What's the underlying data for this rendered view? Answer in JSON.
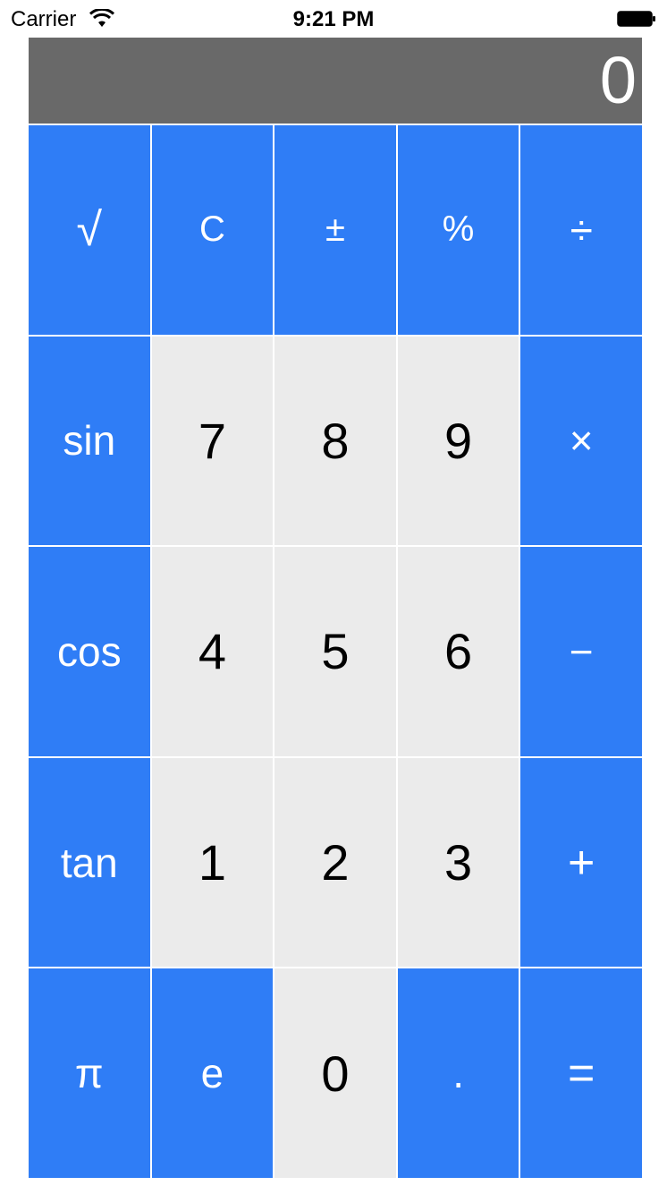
{
  "status_bar": {
    "carrier": "Carrier",
    "time": "9:21 PM",
    "wifi_icon": "wifi-icon",
    "battery_icon": "battery-icon"
  },
  "display": {
    "value": "0"
  },
  "keys": {
    "r0": [
      "√",
      "C",
      "±",
      "%",
      "÷"
    ],
    "r1": [
      "sin",
      "7",
      "8",
      "9",
      "×"
    ],
    "r2": [
      "cos",
      "4",
      "5",
      "6",
      "−"
    ],
    "r3": [
      "tan",
      "1",
      "2",
      "3",
      "+"
    ],
    "r4": [
      "π",
      "e",
      "0",
      ".",
      "="
    ]
  },
  "colors": {
    "function_key": "#2f7df6",
    "digit_key": "#ebebeb",
    "display_bg": "#696969",
    "display_text": "#ffffff"
  }
}
